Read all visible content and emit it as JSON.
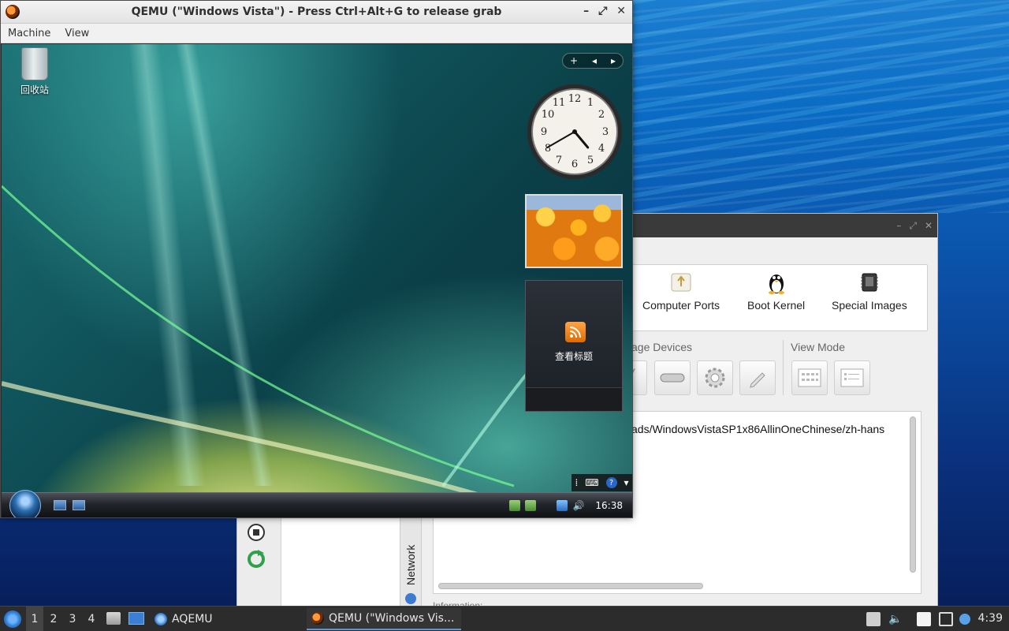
{
  "qemu": {
    "title": "QEMU (\"Windows Vista\") - Press Ctrl+Alt+G to release grab",
    "menu": [
      "Machine",
      "View"
    ],
    "window_buttons": [
      "–",
      "⤢",
      "✕"
    ]
  },
  "vista": {
    "recycle_bin_label": "回收站",
    "sidebar_ctl": [
      "+",
      "◂",
      "▸"
    ],
    "feed_gadget_label": "查看标题",
    "clock": {
      "hour": 4,
      "minute": 40
    },
    "taskbar_time": "16:38"
  },
  "aqemu": {
    "devices": [
      "Computer Ports",
      "Boot Kernel",
      "Special Images"
    ],
    "storage_label": "age Devices",
    "view_mode_label": "View Mode",
    "path_text": "ads/WindowsVistaSP1x86AllinOneChinese/zh-hans",
    "network_tab": "Network",
    "information_label": "Information:"
  },
  "host_taskbar": {
    "workspaces": [
      "1",
      "2",
      "3",
      "4"
    ],
    "tasks": [
      "AQEMU",
      "QEMU (\"Windows Vis..."
    ],
    "clock": "4:39"
  }
}
